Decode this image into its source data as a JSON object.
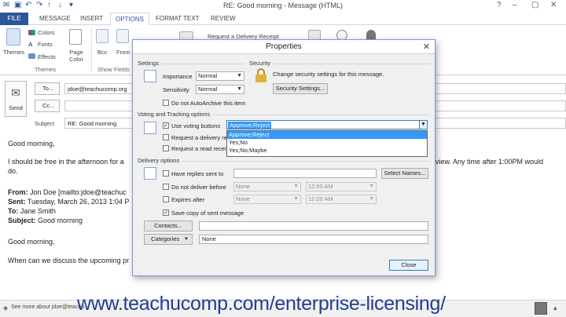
{
  "window": {
    "title": "RE: Good morning - Message (HTML)",
    "help": "?",
    "minimize": "–",
    "maximize": "▢",
    "close": "✕"
  },
  "ribbon_tabs": [
    "FILE",
    "MESSAGE",
    "INSERT",
    "OPTIONS",
    "FORMAT TEXT",
    "REVIEW"
  ],
  "ribbon": {
    "themes_label": "Themes",
    "colors_label": "Colors",
    "fonts_label": "Fonts",
    "effects_label": "Effects",
    "page_color_label": "Page Color",
    "themes_group": "Themes",
    "bcc_label": "Bcc",
    "from_label": "From",
    "show_fields_group": "Show Fields",
    "delivery_receipt_label": "Request a Delivery Receipt"
  },
  "compose": {
    "send_label": "Send",
    "to_button": "To...",
    "cc_button": "Cc...",
    "subject_label": "Subject",
    "to_value": "jdoe@teachucomp.org",
    "cc_value": "",
    "subject_value": "RE: Good morning",
    "body": {
      "greeting": "Good morning,",
      "line1_start": "I should be free in the afternoon for a",
      "line1_end": "view. Any time after 1:00PM would",
      "line2": "do.",
      "from_label": "From:",
      "from_value": "Jon Doe [mailto:jdoe@teachuc",
      "sent_label": "Sent:",
      "sent_value": "Tuesday, March 26, 2013 1:04 P",
      "to_label": "To:",
      "to_value": "Jane Smith",
      "subject_label": "Subject:",
      "subject_value": "Good morning",
      "greeting2": "Good morning,",
      "line3": "When can we discuss the upcoming pr"
    }
  },
  "status": {
    "text": "See more about jdoe@teachu"
  },
  "watermark": "www.teachucomp.com/enterprise-licensing/",
  "dialog": {
    "title": "Properties",
    "close": "✕",
    "settings_section": "Settings",
    "security_section": "Security",
    "importance_label": "Importance",
    "importance_value": "Normal",
    "sensitivity_label": "Sensitivity",
    "sensitivity_value": "Normal",
    "autoarchive_label": "Do not AutoArchive this item",
    "security_text": "Change security settings for this message.",
    "security_button": "Security Settings...",
    "voting_section": "Voting and Tracking options",
    "use_voting_label": "Use voting buttons",
    "voting_value": "Approve;Reject",
    "voting_options": [
      "Approve;Reject",
      "Yes;No",
      "Yes;No;Maybe"
    ],
    "delivery_receipt_label": "Request a delivery re",
    "read_receipt_label": "Request a read recei",
    "delivery_section": "Delivery options",
    "have_replies_label": "Have replies sent to",
    "select_names_button": "Select Names...",
    "do_not_deliver_label": "Do not deliver before",
    "expires_label": "Expires after",
    "date_none": "None",
    "time_value": "12:00 AM",
    "save_copy_label": "Save copy of sent message",
    "contacts_button": "Contacts...",
    "categories_button": "Categories",
    "categories_value": "None",
    "close_button": "Close"
  }
}
